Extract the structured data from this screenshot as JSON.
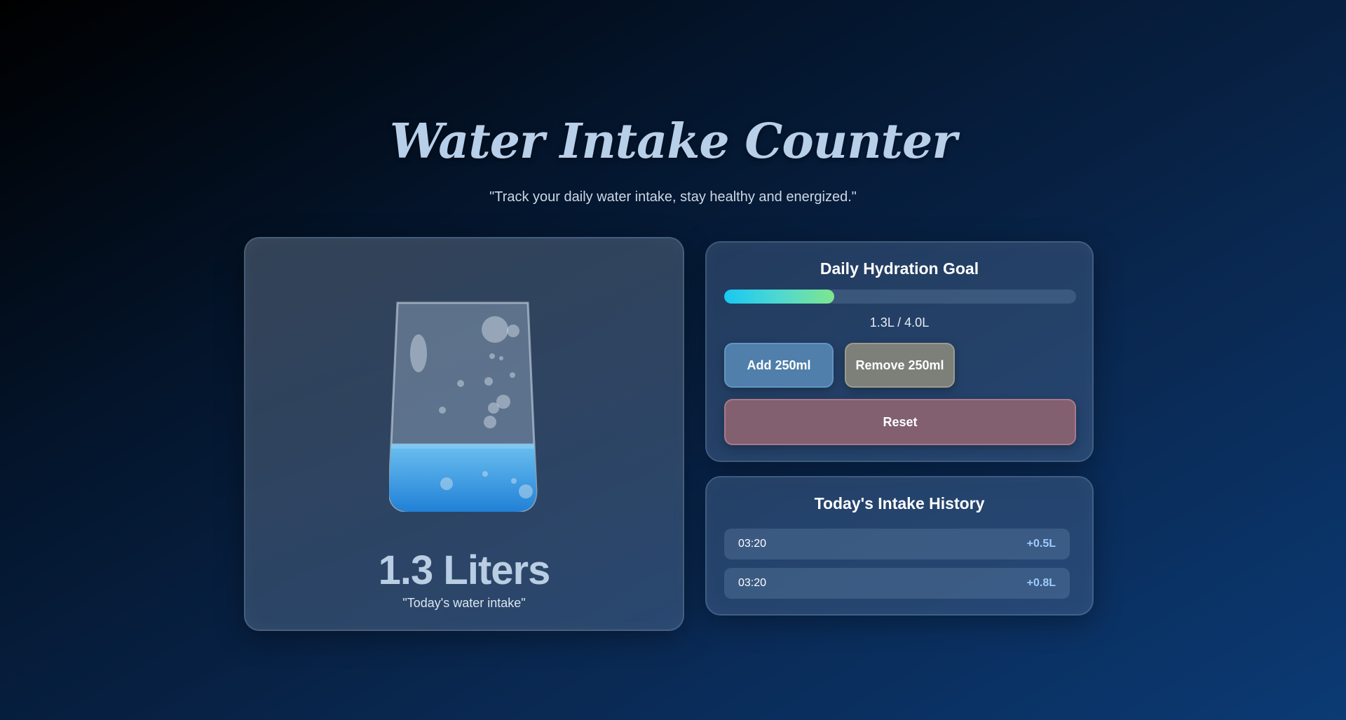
{
  "header": {
    "title": "Water Intake Counter",
    "subtitle": "\"Track your daily water intake, stay healthy and energized.\""
  },
  "glass_panel": {
    "total": "1.3 Liters",
    "caption": "\"Today's water intake\"",
    "fill_fraction": 0.325,
    "water_color": "#3aa2ea"
  },
  "goal": {
    "title": "Daily Hydration Goal",
    "progress_text": "1.3L / 4.0L",
    "progress_fraction": 0.312,
    "buttons": {
      "add": "Add 250ml",
      "remove": "Remove 250ml",
      "reset": "Reset"
    }
  },
  "history": {
    "title": "Today's Intake History",
    "entries": [
      {
        "time": "03:20",
        "amount": "+0.5L"
      },
      {
        "time": "03:20",
        "amount": "+0.8L"
      }
    ]
  },
  "colors": {
    "progress_start": "#18c8f2",
    "progress_end": "#7ee68e",
    "accent_amount": "#9ecbff"
  }
}
